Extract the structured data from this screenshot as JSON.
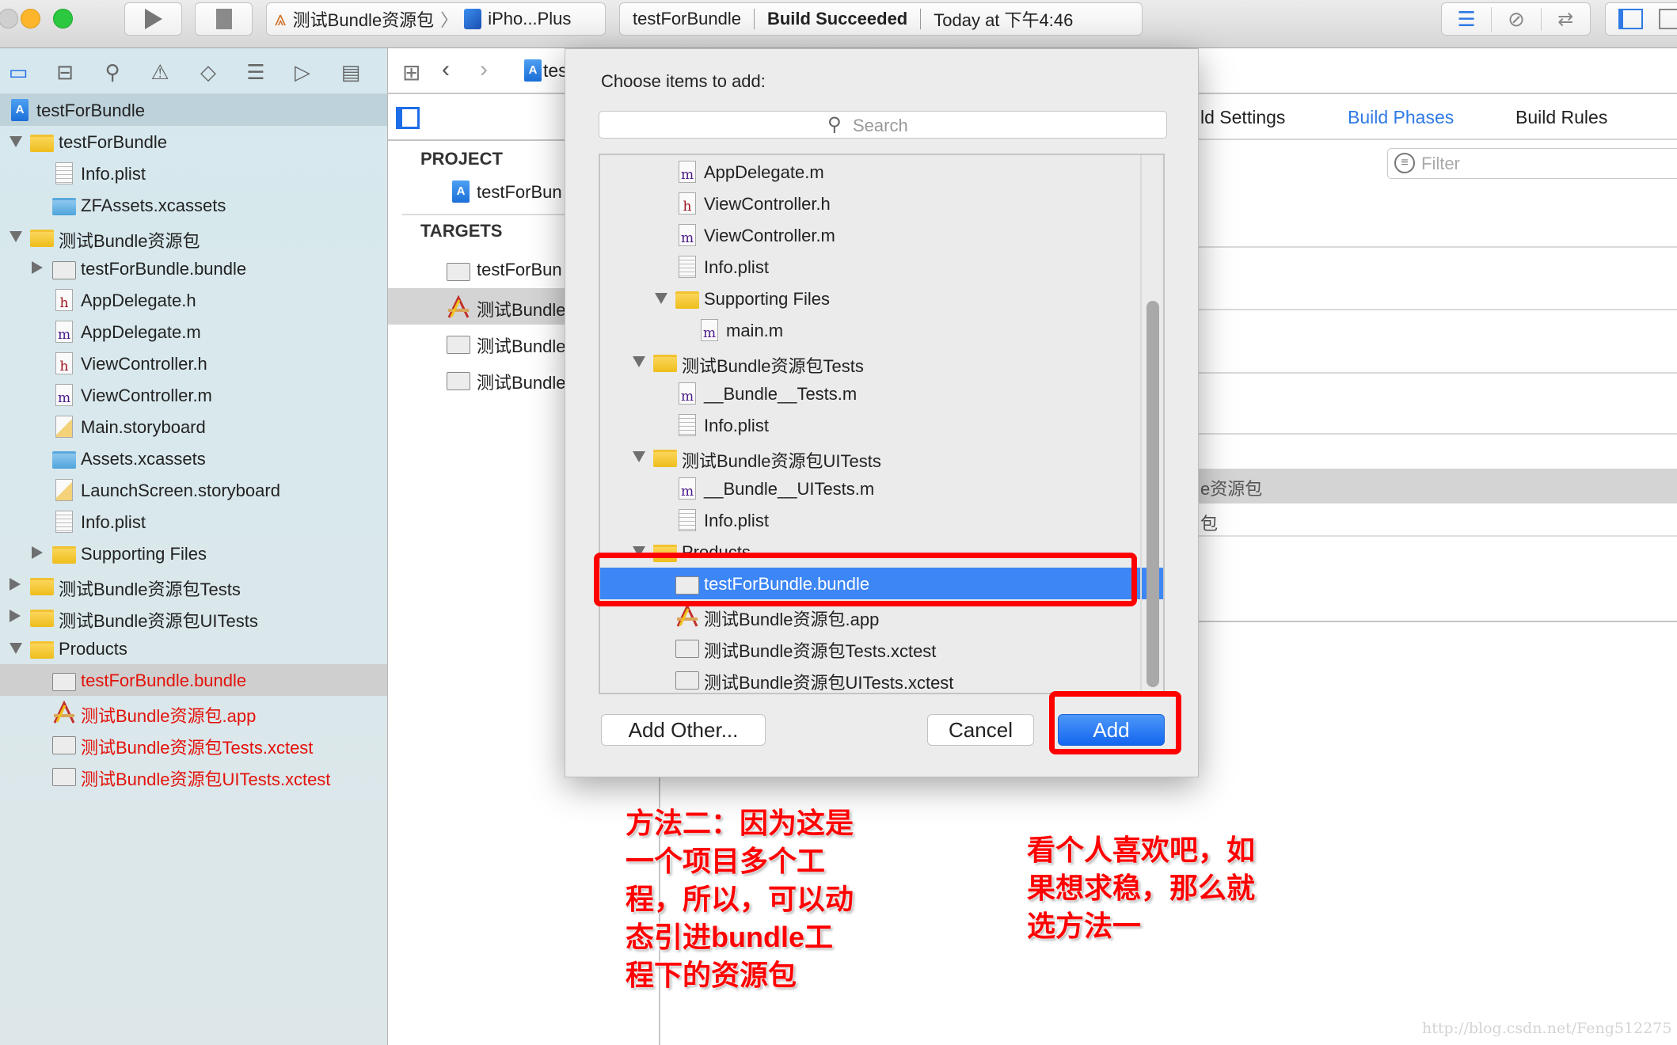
{
  "toolbar": {
    "scheme_target": "测试Bundle资源包",
    "scheme_device": "iPho...Plus",
    "status_project": "testForBundle",
    "status_text": "Build Succeeded",
    "status_time": "Today at 下午4:46"
  },
  "sidebar": {
    "nav_icons": [
      "folder-icon",
      "hierarchy-icon",
      "search-icon",
      "warning-icon",
      "test-diamond-icon",
      "debug-list-icon",
      "breakpoint-icon",
      "report-icon"
    ],
    "tree": [
      {
        "label": "testForBundle",
        "depth": 0,
        "icon": "xcodeproj-icon",
        "highlight": true
      },
      {
        "label": "testForBundle",
        "depth": 1,
        "icon": "folder-icon",
        "expanded": true
      },
      {
        "label": "Info.plist",
        "depth": 2,
        "icon": "plist-icon"
      },
      {
        "label": "ZFAssets.xcassets",
        "depth": 2,
        "icon": "xcassets-icon"
      },
      {
        "label": "测试Bundle资源包",
        "depth": 1,
        "icon": "folder-icon",
        "expanded": true
      },
      {
        "label": "testForBundle.bundle",
        "depth": 2,
        "icon": "bundle-icon",
        "expanded": false
      },
      {
        "label": "AppDelegate.h",
        "depth": 2,
        "icon": "h-file-icon"
      },
      {
        "label": "AppDelegate.m",
        "depth": 2,
        "icon": "m-file-icon"
      },
      {
        "label": "ViewController.h",
        "depth": 2,
        "icon": "h-file-icon"
      },
      {
        "label": "ViewController.m",
        "depth": 2,
        "icon": "m-file-icon"
      },
      {
        "label": "Main.storyboard",
        "depth": 2,
        "icon": "storyboard-icon"
      },
      {
        "label": "Assets.xcassets",
        "depth": 2,
        "icon": "xcassets-icon"
      },
      {
        "label": "LaunchScreen.storyboard",
        "depth": 2,
        "icon": "storyboard-icon"
      },
      {
        "label": "Info.plist",
        "depth": 2,
        "icon": "plist-icon"
      },
      {
        "label": "Supporting Files",
        "depth": 2,
        "icon": "folder-icon",
        "expanded": false
      },
      {
        "label": "测试Bundle资源包Tests",
        "depth": 1,
        "icon": "folder-icon",
        "expanded": false
      },
      {
        "label": "测试Bundle资源包UITests",
        "depth": 1,
        "icon": "folder-icon",
        "expanded": false
      },
      {
        "label": "Products",
        "depth": 1,
        "icon": "folder-icon",
        "expanded": true
      },
      {
        "label": "testForBundle.bundle",
        "depth": 2,
        "icon": "bundle-icon",
        "missing": true,
        "selected": true
      },
      {
        "label": "测试Bundle资源包.app",
        "depth": 2,
        "icon": "app-icon",
        "missing": true
      },
      {
        "label": "测试Bundle资源包Tests.xctest",
        "depth": 2,
        "icon": "bundle-icon",
        "missing": true
      },
      {
        "label": "测试Bundle资源包UITests.xctest",
        "depth": 2,
        "icon": "bundle-icon",
        "missing": true
      }
    ]
  },
  "editor": {
    "breadcrumb": "tes",
    "project_header": "PROJECT",
    "project_item": "testForBun",
    "targets_header": "TARGETS",
    "targets": [
      {
        "label": "testForBun",
        "icon": "bundle-icon"
      },
      {
        "label": "测试Bundle",
        "icon": "app-icon",
        "selected": true
      },
      {
        "label": "测试Bundle",
        "icon": "bundle-icon"
      },
      {
        "label": "测试Bundle",
        "icon": "bundle-icon"
      }
    ],
    "tabs": [
      {
        "label": "ld Settings"
      },
      {
        "label": "Build Phases",
        "active": true
      },
      {
        "label": "Build Rules"
      }
    ],
    "filter_placeholder": "Filter",
    "phase_rows": [
      "e资源包",
      "包"
    ]
  },
  "dialog": {
    "title": "Choose items to add:",
    "search_placeholder": "Search",
    "items": [
      {
        "label": "AppDelegate.m",
        "depth": 3,
        "icon": "m-file-icon"
      },
      {
        "label": "ViewController.h",
        "depth": 3,
        "icon": "h-file-icon"
      },
      {
        "label": "ViewController.m",
        "depth": 3,
        "icon": "m-file-icon"
      },
      {
        "label": "Info.plist",
        "depth": 3,
        "icon": "plist-icon"
      },
      {
        "label": "Supporting Files",
        "depth": 3,
        "icon": "folder-icon",
        "expanded": true
      },
      {
        "label": "main.m",
        "depth": 4,
        "icon": "m-file-icon"
      },
      {
        "label": "测试Bundle资源包Tests",
        "depth": 2,
        "icon": "folder-icon",
        "expanded": true
      },
      {
        "label": "__Bundle__Tests.m",
        "depth": 3,
        "icon": "m-file-icon"
      },
      {
        "label": "Info.plist",
        "depth": 3,
        "icon": "plist-icon"
      },
      {
        "label": "测试Bundle资源包UITests",
        "depth": 2,
        "icon": "folder-icon",
        "expanded": true
      },
      {
        "label": "__Bundle__UITests.m",
        "depth": 3,
        "icon": "m-file-icon"
      },
      {
        "label": "Info.plist",
        "depth": 3,
        "icon": "plist-icon"
      },
      {
        "label": "Products",
        "depth": 2,
        "icon": "folder-icon",
        "expanded": true
      },
      {
        "label": "testForBundle.bundle",
        "depth": 3,
        "icon": "bundle-icon",
        "selected": true
      },
      {
        "label": "测试Bundle资源包.app",
        "depth": 3,
        "icon": "app-icon"
      },
      {
        "label": "测试Bundle资源包Tests.xctest",
        "depth": 3,
        "icon": "bundle-icon"
      },
      {
        "label": "测试Bundle资源包UITests.xctest",
        "depth": 3,
        "icon": "bundle-icon"
      }
    ],
    "add_other_label": "Add Other...",
    "cancel_label": "Cancel",
    "add_label": "Add"
  },
  "annotations": {
    "left": [
      "方法二：因为这是",
      "一个项目多个工",
      "程，所以，可以动",
      "态引进bundle工",
      "程下的资源包"
    ],
    "right": [
      "看个人喜欢吧，如",
      "果想求稳，那么就",
      "选方法一"
    ]
  },
  "watermark": "http://blog.csdn.net/Feng512275",
  "colors": {
    "accent": "#2f7ae5",
    "selection": "#3d86f5",
    "missing_file": "#e3120b",
    "annotation": "#ff0000"
  }
}
